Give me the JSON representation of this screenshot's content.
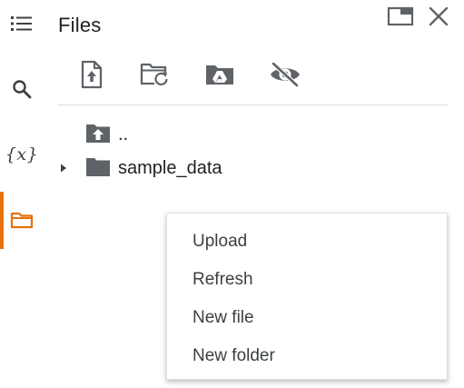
{
  "rail": {
    "items": [
      {
        "name": "table-of-contents",
        "icon": "list-icon"
      },
      {
        "name": "search",
        "icon": "search-icon"
      },
      {
        "name": "variables",
        "icon": "variables-icon",
        "glyph": "{x}"
      },
      {
        "name": "files",
        "icon": "folder-icon",
        "active": true
      }
    ],
    "accent_color": "#e8710a"
  },
  "panel": {
    "title": "Files",
    "window_buttons": [
      {
        "name": "open-in-tab",
        "icon": "window-icon"
      },
      {
        "name": "close",
        "icon": "close-icon"
      }
    ]
  },
  "toolbar": {
    "buttons": [
      {
        "name": "upload",
        "icon": "upload-file-icon"
      },
      {
        "name": "refresh",
        "icon": "folder-refresh-icon"
      },
      {
        "name": "mount-drive",
        "icon": "drive-folder-icon"
      },
      {
        "name": "toggle-hidden",
        "icon": "eye-off-icon"
      }
    ]
  },
  "tree": {
    "items": [
      {
        "label": "..",
        "icon": "parent-folder-icon"
      },
      {
        "label": "sample_data",
        "icon": "folder-icon",
        "collapsed": true
      }
    ]
  },
  "context_menu": {
    "items": [
      "Upload",
      "Refresh",
      "New file",
      "New folder"
    ]
  }
}
